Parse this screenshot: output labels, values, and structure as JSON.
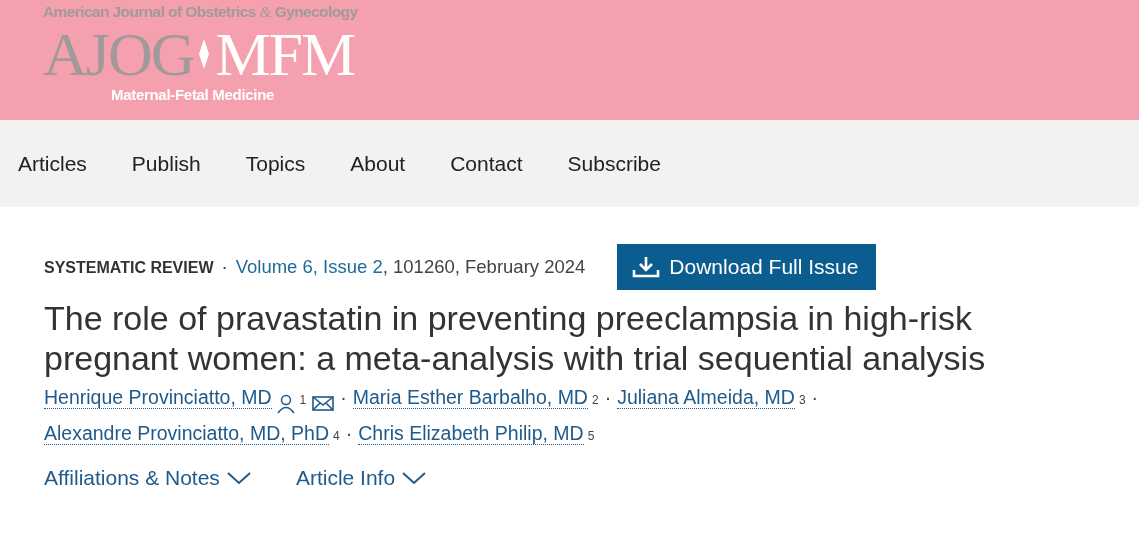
{
  "header": {
    "journal_name": [
      "American Journal of Obstetrics",
      "&",
      "Gynecology"
    ],
    "abbreviation": "AJOG",
    "section_abbreviation": "MFM",
    "subtitle": "Maternal-Fetal Medicine"
  },
  "nav": [
    {
      "label": "Articles"
    },
    {
      "label": "Publish"
    },
    {
      "label": "Topics"
    },
    {
      "label": "About"
    },
    {
      "label": "Contact"
    },
    {
      "label": "Subscribe"
    }
  ],
  "article": {
    "type": "SYSTEMATIC REVIEW",
    "separator": "·",
    "issue_link": "Volume 6, Issue 2",
    "issue_rest": ", 101260, February 2024",
    "download_button": "Download Full Issue",
    "title": "The role of pravastatin in preventing preeclampsia in high-risk pregnant women: a meta-analysis with trial sequential analysis",
    "author_lines": [
      [
        {
          "name": "Henrique Provinciatto, MD",
          "name_icons": [
            {
              "kind": "person"
            }
          ],
          "sup": "1",
          "contact_icons": [
            {
              "kind": "mail"
            }
          ],
          "separator": "·"
        },
        {
          "name": "Maria Esther Barbalho, MD",
          "sup": "2",
          "separator": "·"
        },
        {
          "name": "Juliana Almeida, MD",
          "sup": "3",
          "separator": "·"
        }
      ],
      [
        {
          "name": "Alexandre Provinciatto, MD, PhD",
          "sup": "4",
          "separator": "·"
        },
        {
          "name": "Chris Elizabeth Philip, MD",
          "sup": "5"
        }
      ]
    ],
    "toggles": [
      {
        "label": "Affiliations & Notes",
        "expanded": false
      },
      {
        "label": "Article Info",
        "expanded": false
      }
    ]
  }
}
